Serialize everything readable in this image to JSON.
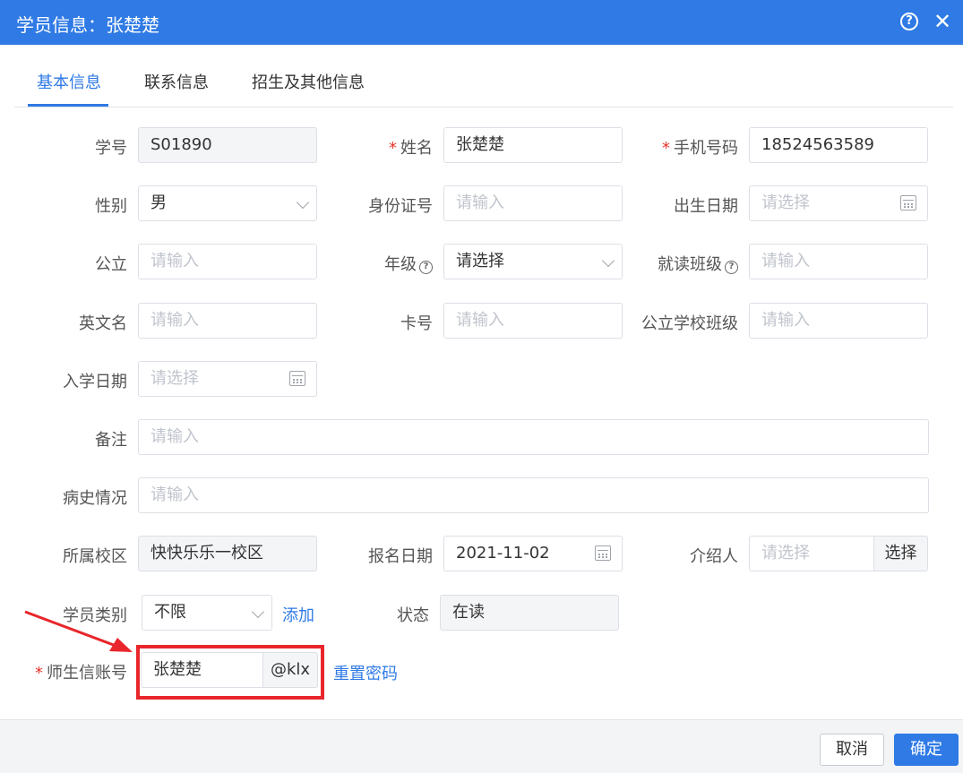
{
  "dialog": {
    "title": "学员信息：张楚楚",
    "help_icon": "question-circle-icon",
    "close_icon": "close-icon",
    "close_glyph": "✕",
    "help_glyph": "?"
  },
  "tabs": [
    {
      "label": "基本信息",
      "active": true
    },
    {
      "label": "联系信息",
      "active": false
    },
    {
      "label": "招生及其他信息",
      "active": false
    }
  ],
  "form": {
    "student_no": {
      "label": "学号",
      "value": "S01890"
    },
    "name": {
      "label": "姓名",
      "required_mark": "*",
      "value": "张楚楚"
    },
    "mobile": {
      "label": "手机号码",
      "required_mark": "*",
      "value": "18524563589"
    },
    "gender": {
      "label": "性别",
      "value": "男"
    },
    "id_card": {
      "label": "身份证号",
      "placeholder": "请输入"
    },
    "birthday": {
      "label": "出生日期",
      "placeholder": "请选择"
    },
    "public_school": {
      "label": "公立",
      "placeholder": "请输入"
    },
    "grade": {
      "label": "年级",
      "value": "请选择"
    },
    "class": {
      "label": "就读班级",
      "placeholder": "请输入"
    },
    "english_name": {
      "label": "英文名",
      "placeholder": "请输入"
    },
    "card_no": {
      "label": "卡号",
      "placeholder": "请输入"
    },
    "public_school_class": {
      "label": "公立学校班级",
      "placeholder": "请输入"
    },
    "enroll_date": {
      "label": "入学日期",
      "placeholder": "请选择"
    },
    "remark": {
      "label": "备注",
      "placeholder": "请输入"
    },
    "medical_history": {
      "label": "病史情况",
      "placeholder": "请输入"
    },
    "campus": {
      "label": "所属校区",
      "value": "快快乐乐一校区"
    },
    "signup_date": {
      "label": "报名日期",
      "value": "2021-11-02"
    },
    "referrer": {
      "label": "介绍人",
      "placeholder": "请选择",
      "button": "选择"
    },
    "student_type": {
      "label": "学员类别",
      "value": "不限",
      "add_link": "添加"
    },
    "status": {
      "label": "状态",
      "value": "在读"
    },
    "account": {
      "label": "师生信账号",
      "required_mark": "*",
      "value": "张楚楚",
      "suffix": "@klx",
      "reset_link": "重置密码"
    }
  },
  "footer": {
    "cancel": "取消",
    "confirm": "确定"
  },
  "colors": {
    "primary": "#2f7ae5",
    "required": "#e5342a",
    "annotation": "#e8262b"
  }
}
